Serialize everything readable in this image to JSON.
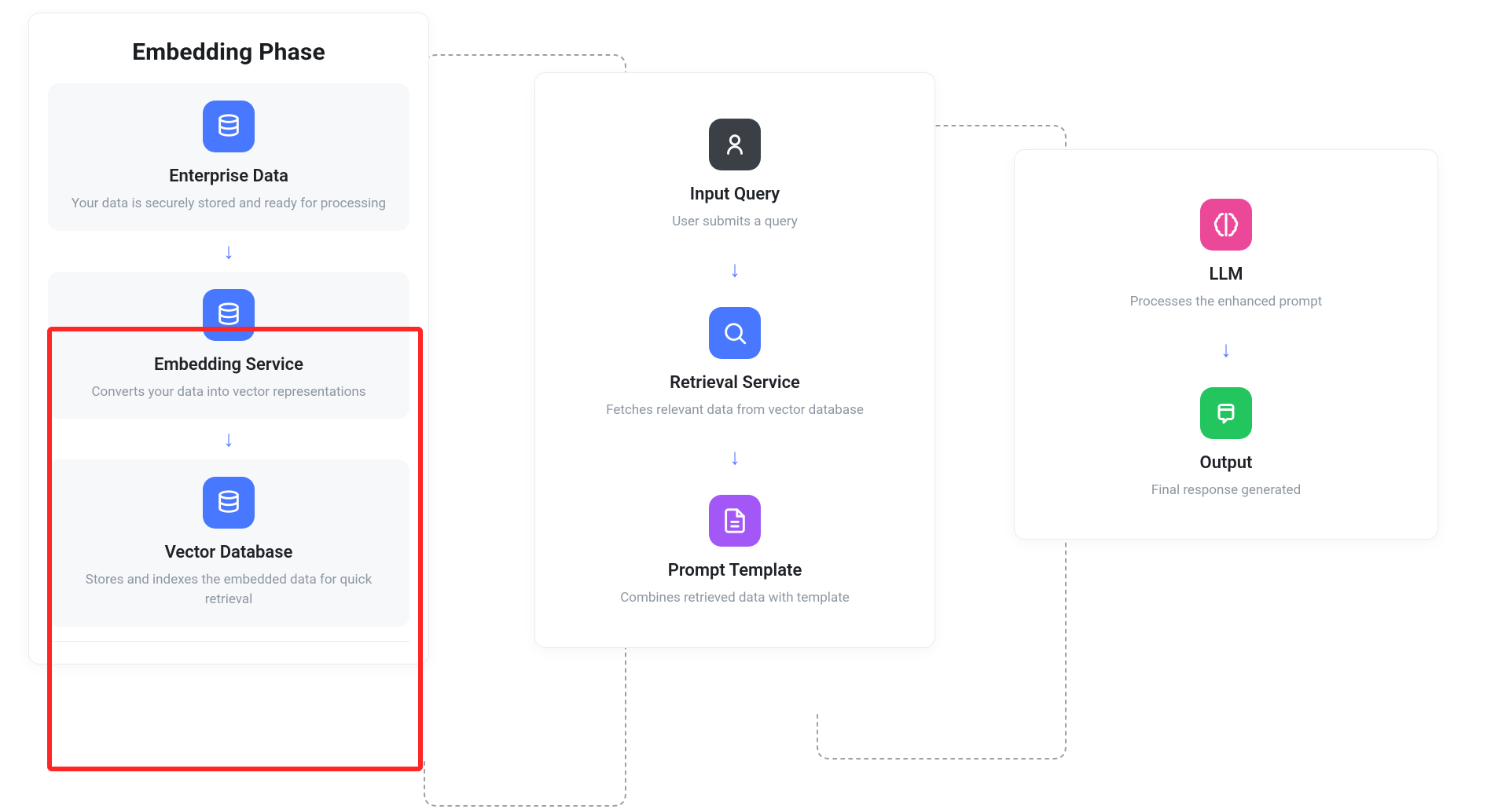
{
  "arrow_glyph": "↓",
  "panels": {
    "embedding": {
      "title": "Embedding Phase",
      "cards": [
        {
          "icon": "database-icon",
          "bg": "bg-blue",
          "title": "Enterprise Data",
          "desc": "Your data is securely stored and ready for processing"
        },
        {
          "icon": "database-icon",
          "bg": "bg-blue",
          "title": "Embedding Service",
          "desc": "Converts your data into vector representations"
        },
        {
          "icon": "database-icon",
          "bg": "bg-blue",
          "title": "Vector Database",
          "desc": "Stores and indexes the embedded data for quick retrieval"
        }
      ]
    },
    "retrieval": {
      "cards": [
        {
          "icon": "user-icon",
          "bg": "bg-dark",
          "title": "Input Query",
          "desc": "User submits a query"
        },
        {
          "icon": "search-icon",
          "bg": "bg-blue",
          "title": "Retrieval Service",
          "desc": "Fetches relevant data from vector database"
        },
        {
          "icon": "document-icon",
          "bg": "bg-purple",
          "title": "Prompt Template",
          "desc": "Combines retrieved data with template"
        }
      ]
    },
    "generation": {
      "cards": [
        {
          "icon": "brain-icon",
          "bg": "bg-pink",
          "title": "LLM",
          "desc": "Processes the enhanced prompt"
        },
        {
          "icon": "chat-icon",
          "bg": "bg-green",
          "title": "Output",
          "desc": "Final response generated"
        }
      ]
    }
  }
}
